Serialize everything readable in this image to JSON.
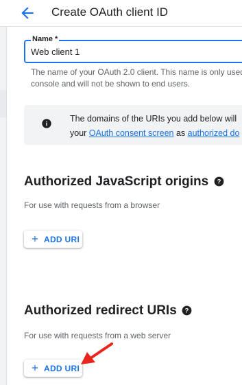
{
  "header": {
    "title": "Create OAuth client ID",
    "back_icon": "arrow-back-icon"
  },
  "name_field": {
    "label": "Name *",
    "value": "Web client 1",
    "helper_line1": "The name of your OAuth 2.0 client. This name is only used",
    "helper_line2": "console and will not be shown to end users."
  },
  "info": {
    "line1": "The domains of the URIs you add below will",
    "line2_prefix": "your ",
    "link1": "OAuth consent screen",
    "line2_mid": " as ",
    "link2": "authorized do"
  },
  "js_origins": {
    "title": "Authorized JavaScript origins",
    "subtitle": "For use with requests from a browser",
    "button": "ADD URI"
  },
  "redirect_uris": {
    "title": "Authorized redirect URIs",
    "subtitle": "For use with requests from a web server",
    "button": "ADD URI"
  },
  "colors": {
    "accent": "#1a73e8",
    "annotation_arrow": "#e8261e",
    "info_bg": "#f1f3f4"
  }
}
